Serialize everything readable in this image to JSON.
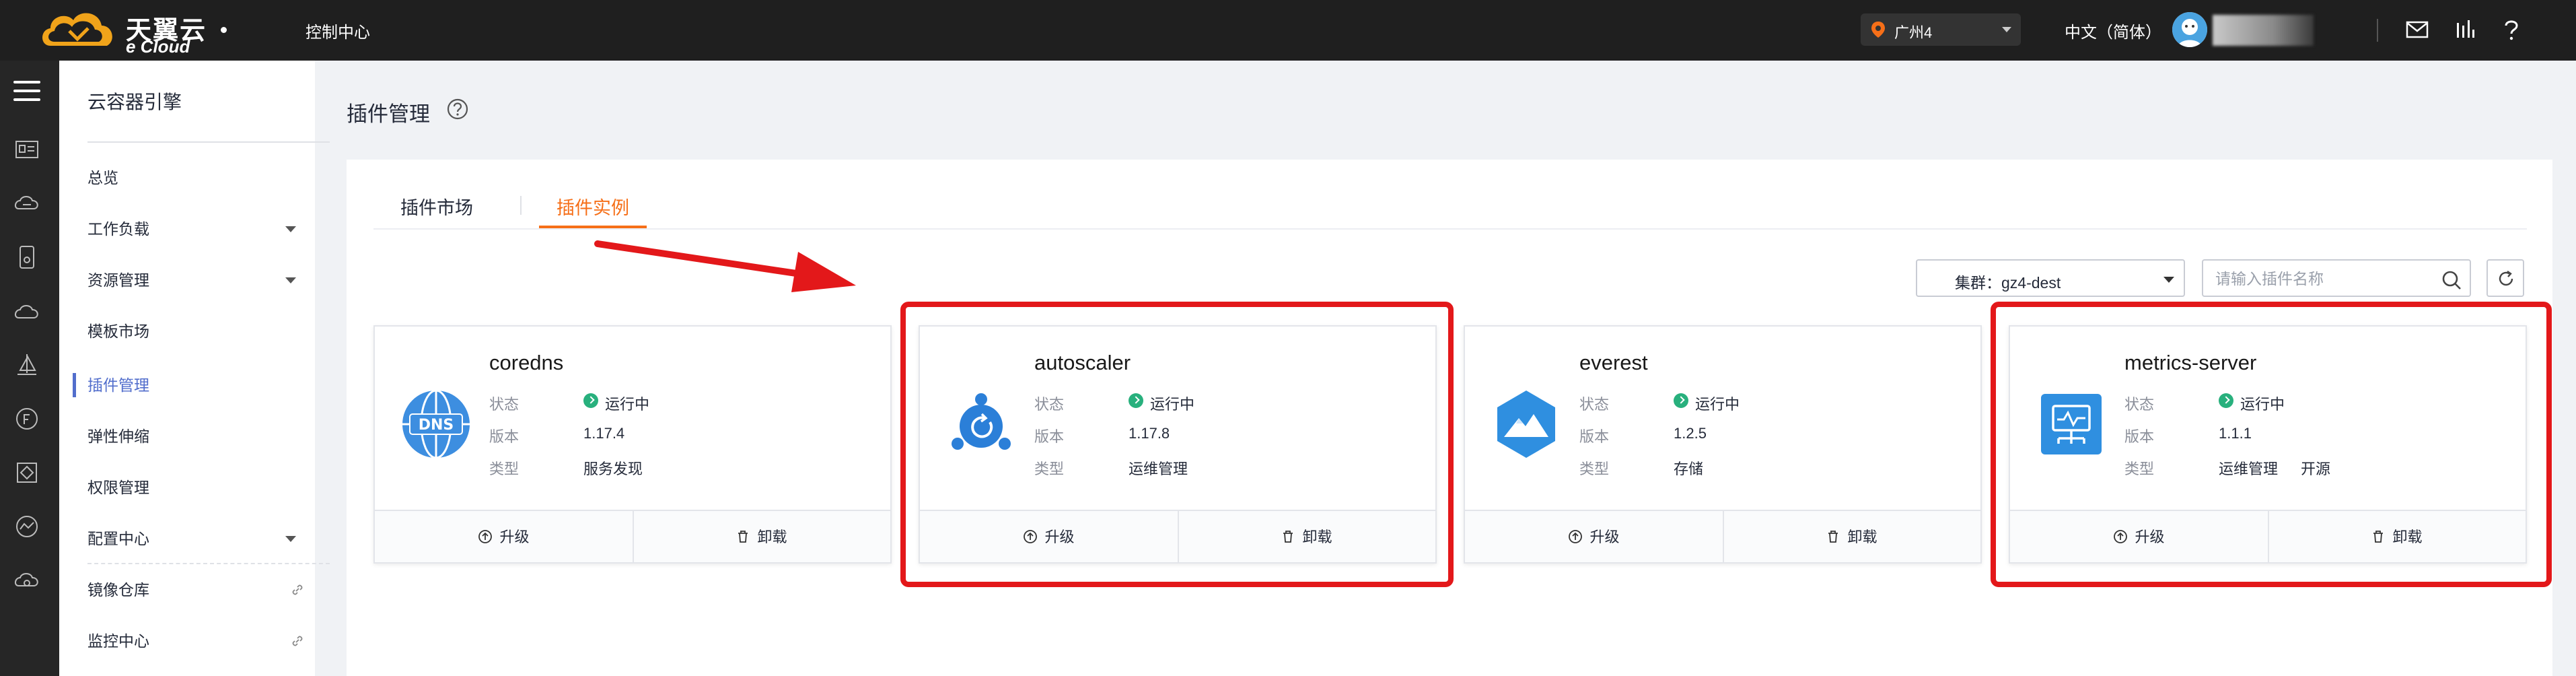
{
  "topbar": {
    "brand_cn": "天翼云",
    "brand_en": "e Cloud",
    "console": "控制中心",
    "region": "广州4",
    "language": "中文（简体）"
  },
  "sidebar": {
    "title": "云容器引擎",
    "items": [
      {
        "label": "总览"
      },
      {
        "label": "工作负载"
      },
      {
        "label": "资源管理"
      },
      {
        "label": "模板市场"
      },
      {
        "label": "插件管理"
      },
      {
        "label": "弹性伸缩"
      },
      {
        "label": "权限管理"
      },
      {
        "label": "配置中心"
      },
      {
        "label": "镜像仓库"
      },
      {
        "label": "监控中心"
      }
    ]
  },
  "page": {
    "title": "插件管理",
    "tabs": [
      {
        "label": "插件市场"
      },
      {
        "label": "插件实例"
      }
    ],
    "cluster_label": "集群：gz4-dest",
    "search_placeholder": "请输入插件名称"
  },
  "labels": {
    "status": "状态",
    "version": "版本",
    "type": "类型",
    "upgrade": "升级",
    "uninstall": "卸载"
  },
  "plugins": [
    {
      "name": "coredns",
      "status": "运行中",
      "version": "1.17.4",
      "type": "服务发现",
      "icon": "dns-globe-icon"
    },
    {
      "name": "autoscaler",
      "status": "运行中",
      "version": "1.17.8",
      "type": "运维管理",
      "icon": "autoscaler-icon"
    },
    {
      "name": "everest",
      "status": "运行中",
      "version": "1.2.5",
      "type": "存储",
      "icon": "everest-mountain-icon"
    },
    {
      "name": "metrics-server",
      "status": "运行中",
      "version": "1.1.1",
      "type": "运维管理",
      "type2": "开源",
      "icon": "metrics-monitor-icon"
    }
  ],
  "colors": {
    "accent_orange": "#f66f18",
    "nav_active": "#526ecc",
    "status_green": "#28b07d",
    "annotation_red": "#e3181a"
  }
}
